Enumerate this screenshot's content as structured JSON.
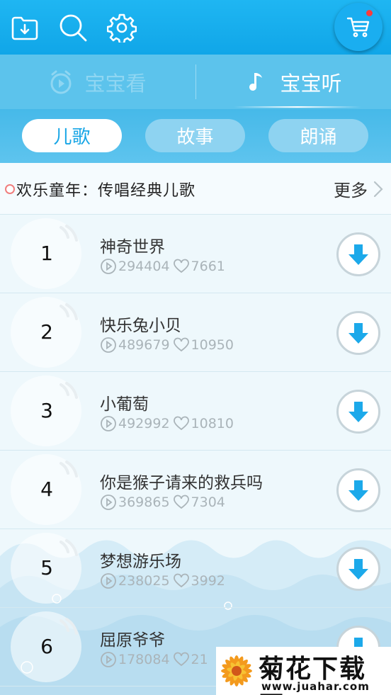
{
  "colors": {
    "accent": "#10a6e8",
    "tab_active_text": "#18a6e6",
    "download_arrow": "#1ca9ea",
    "cart_badge": "#ff3b3b"
  },
  "topbar": {
    "icons": [
      "download-folder-icon",
      "search-icon",
      "gear-icon"
    ],
    "cart_icon": "cart-icon"
  },
  "modes": {
    "watch_label": "宝宝看",
    "listen_label": "宝宝听",
    "selected": "宝宝听"
  },
  "tabs": [
    {
      "label": "儿歌",
      "active": true
    },
    {
      "label": "故事",
      "active": false
    },
    {
      "label": "朗诵",
      "active": false
    }
  ],
  "section": {
    "title": "欢乐童年：传唱经典儿歌",
    "more_label": "更多"
  },
  "songs": [
    {
      "rank": "1",
      "title": "神奇世界",
      "plays": "294404",
      "likes": "7661"
    },
    {
      "rank": "2",
      "title": "快乐兔小贝",
      "plays": "489679",
      "likes": "10950"
    },
    {
      "rank": "3",
      "title": "小葡萄",
      "plays": "492992",
      "likes": "10810"
    },
    {
      "rank": "4",
      "title": "你是猴子请来的救兵吗",
      "plays": "369865",
      "likes": "7304"
    },
    {
      "rank": "5",
      "title": "梦想游乐场",
      "plays": "238025",
      "likes": "3992"
    },
    {
      "rank": "6",
      "title": "屈原爷爷",
      "plays": "178084",
      "likes": "21"
    }
  ],
  "watermark": {
    "title": "菊花下载网",
    "url": "www.juahar.com"
  }
}
